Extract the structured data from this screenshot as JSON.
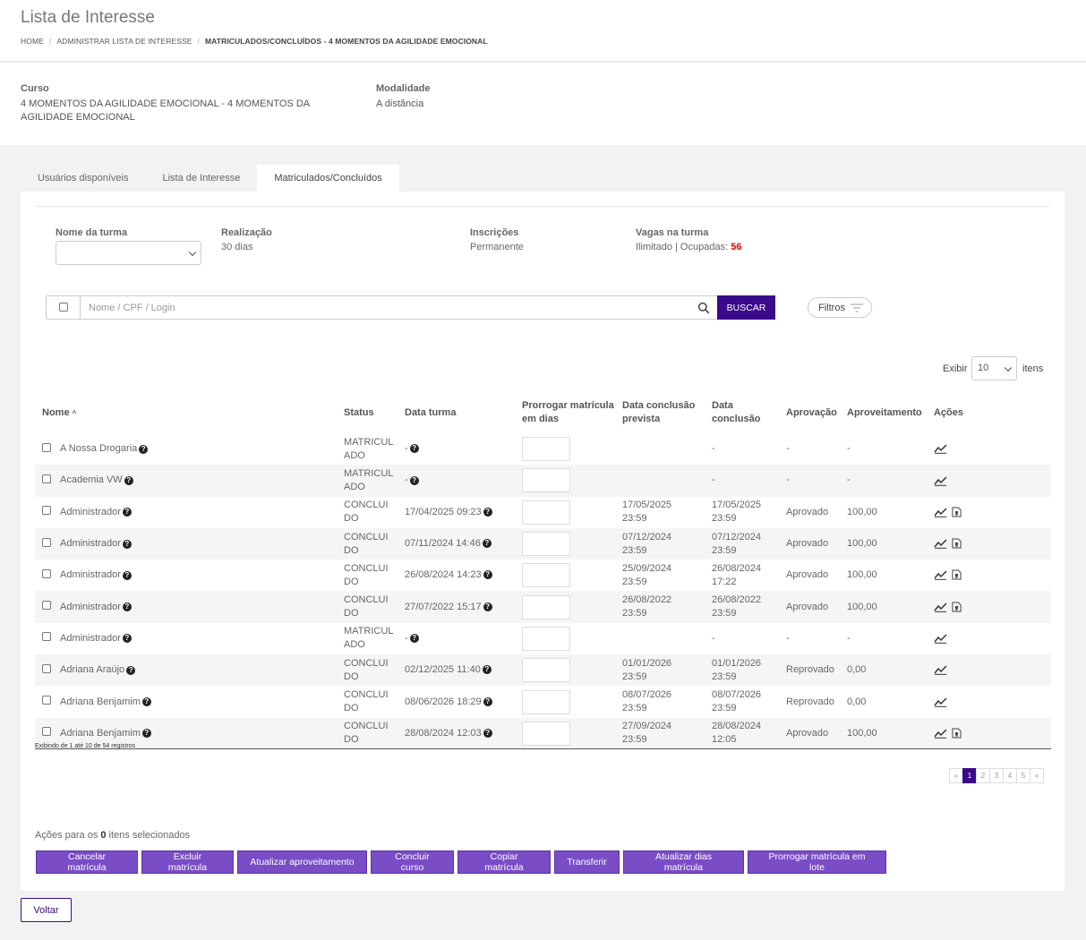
{
  "header": {
    "title": "Lista de Interesse",
    "breadcrumb": [
      "HOME",
      "ADMINISTRAR LISTA DE INTERESSE",
      "MATRICULADOS/CONCLUÍDOS - 4 MOMENTOS DA AGILIDADE EMOCIONAL"
    ]
  },
  "course": {
    "curso_label": "Curso",
    "curso_value": "4 MOMENTOS DA AGILIDADE EMOCIONAL - 4 MOMENTOS DA AGILIDADE EMOCIONAL",
    "modalidade_label": "Modalidade",
    "modalidade_value": "A distância"
  },
  "tabs": [
    {
      "label": "Usuários disponíveis",
      "active": false
    },
    {
      "label": "Lista de Interesse",
      "active": false
    },
    {
      "label": "Matriculados/Concluídos",
      "active": true
    }
  ],
  "turma": {
    "nome_label": "Nome da turma",
    "nome_value": "",
    "realizacao_label": "Realização",
    "realizacao_value": "30 dias",
    "inscricoes_label": "Inscrições",
    "inscricoes_value": "Permanente",
    "vagas_label": "Vagas na turma",
    "vagas_value": "Ilimitado | Ocupadas: ",
    "ocupadas": "56"
  },
  "search": {
    "placeholder": "Nome / CPF / Login",
    "button": "BUSCAR",
    "filtros": "Filtros"
  },
  "pagesize": {
    "exibir": "Exibir",
    "value": "10",
    "options": [
      "10"
    ],
    "itens": "itens"
  },
  "table": {
    "headers": {
      "nome": "Nome",
      "status": "Status",
      "data_turma": "Data turma",
      "prorrogar": "Prorrogar matrícula em dias",
      "prevista": "Data conclusão prevista",
      "conclusao": "Data conclusão",
      "aprovacao": "Aprovação",
      "aproveitamento": "Aproveitamento",
      "acoes": "Ações"
    },
    "rows": [
      {
        "nome": "A Nossa Drogaria",
        "status": "MATRICULADO",
        "data_turma": "-",
        "prevista": "",
        "conclusao": "-",
        "aprovacao": "-",
        "aproveitamento": "-",
        "cert": false
      },
      {
        "nome": "Academia VW",
        "status": "MATRICULADO",
        "data_turma": "-",
        "prevista": "",
        "conclusao": "-",
        "aprovacao": "-",
        "aproveitamento": "-",
        "cert": false
      },
      {
        "nome": "Administrador",
        "status": "CONCLUIDO",
        "data_turma": "17/04/2025 09:23",
        "prevista": "17/05/2025 23:59",
        "conclusao": "17/05/2025 23:59",
        "aprovacao": "Aprovado",
        "aproveitamento": "100,00",
        "cert": true
      },
      {
        "nome": "Administrador",
        "status": "CONCLUIDO",
        "data_turma": "07/11/2024 14:46",
        "prevista": "07/12/2024 23:59",
        "conclusao": "07/12/2024 23:59",
        "aprovacao": "Aprovado",
        "aproveitamento": "100,00",
        "cert": true
      },
      {
        "nome": "Administrador",
        "status": "CONCLUIDO",
        "data_turma": "26/08/2024 14:23",
        "prevista": "25/09/2024 23:59",
        "conclusao": "26/08/2024 17:22",
        "aprovacao": "Aprovado",
        "aproveitamento": "100,00",
        "cert": true
      },
      {
        "nome": "Administrador",
        "status": "CONCLUIDO",
        "data_turma": "27/07/2022 15:17",
        "prevista": "26/08/2022 23:59",
        "conclusao": "26/08/2022 23:59",
        "aprovacao": "Aprovado",
        "aproveitamento": "100,00",
        "cert": true
      },
      {
        "nome": "Administrador",
        "status": "MATRICULADO",
        "data_turma": "-",
        "prevista": "",
        "conclusao": "-",
        "aprovacao": "-",
        "aproveitamento": "-",
        "cert": false
      },
      {
        "nome": "Adriana Araújo",
        "status": "CONCLUIDO",
        "data_turma": "02/12/2025 11:40",
        "prevista": "01/01/2026 23:59",
        "conclusao": "01/01/2026 23:59",
        "aprovacao": "Reprovado",
        "aproveitamento": "0,00",
        "cert": false
      },
      {
        "nome": "Adriana Benjamim",
        "status": "CONCLUIDO",
        "data_turma": "08/06/2026 18:29",
        "prevista": "08/07/2026 23:59",
        "conclusao": "08/07/2026 23:59",
        "aprovacao": "Reprovado",
        "aproveitamento": "0,00",
        "cert": false
      },
      {
        "nome": "Adriana Benjamim",
        "status": "CONCLUIDO",
        "data_turma": "28/08/2024 12:03",
        "prevista": "27/09/2024 23:59",
        "conclusao": "28/08/2024 12:05",
        "aprovacao": "Aprovado",
        "aproveitamento": "100,00",
        "cert": true
      }
    ]
  },
  "records_text": "Exibindo de 1 até 10 de 54 registros",
  "pagination": {
    "first": "«",
    "pages": [
      "1",
      "2",
      "3",
      "4",
      "5"
    ],
    "active": "1",
    "last": "»"
  },
  "selection": {
    "prefix": "Ações para os ",
    "count": "0",
    "suffix": " itens selecionados"
  },
  "actions": [
    "Cancelar matrícula",
    "Excluir matrícula",
    "Atualizar aproveitamento",
    "Concluir curso",
    "Copiar matrícula",
    "Transferir",
    "Atualizar dias matrícula",
    "Prorrogar matrícula em lote"
  ],
  "back_button": "Voltar",
  "colors": {
    "primary": "#3b0a8a",
    "action": "#7a4cc6",
    "alert": "#e00000"
  }
}
